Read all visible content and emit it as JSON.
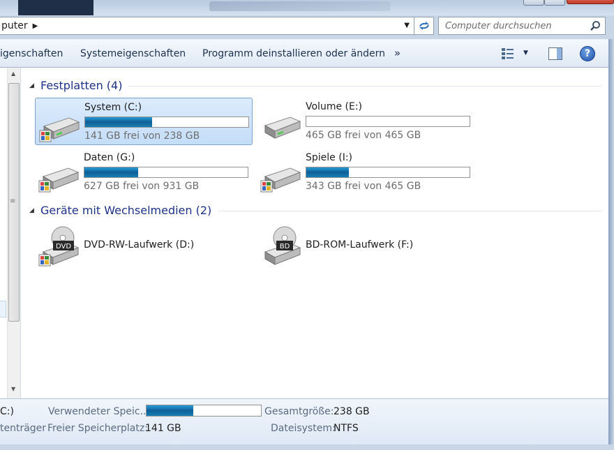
{
  "address": {
    "crumb": "puter"
  },
  "search": {
    "placeholder": "Computer durchsuchen"
  },
  "toolbar": {
    "items": [
      "igenschaften",
      "Systemeigenschaften",
      "Programm deinstallieren oder ändern"
    ],
    "more": "»"
  },
  "groups": {
    "hdd": {
      "title": "Festplatten (4)"
    },
    "removable": {
      "title": "Geräte mit Wechselmedien (2)"
    }
  },
  "drives": [
    {
      "name": "System (C:)",
      "free": "141 GB frei von 238 GB",
      "used_fraction": 0.41
    },
    {
      "name": "Volume (E:)",
      "free": "465 GB frei von 465 GB",
      "used_fraction": 0.0
    },
    {
      "name": "Daten (G:)",
      "free": "627 GB frei von 931 GB",
      "used_fraction": 0.33
    },
    {
      "name": "Spiele (I:)",
      "free": "343 GB frei von 465 GB",
      "used_fraction": 0.26
    }
  ],
  "removable": [
    {
      "name": "DVD-RW-Laufwerk (D:)",
      "badge": "DVD"
    },
    {
      "name": "BD-ROM-Laufwerk (F:)",
      "badge": "BD"
    }
  ],
  "details": {
    "name_partial": "C:)",
    "type_partial": "tenträger",
    "used_label": "Verwendeter Speic...",
    "used_fraction": 0.41,
    "free_label": "Freier Speicherplatz:",
    "free_value": "141 GB",
    "total_label": "Gesamtgröße:",
    "total_value": "238 GB",
    "fs_label": "Dateisystem:",
    "fs_value": "NTFS"
  },
  "colors": {
    "accent_bar": "#1577b0",
    "group_title": "#1e3287",
    "selection": "#cde3fa"
  }
}
